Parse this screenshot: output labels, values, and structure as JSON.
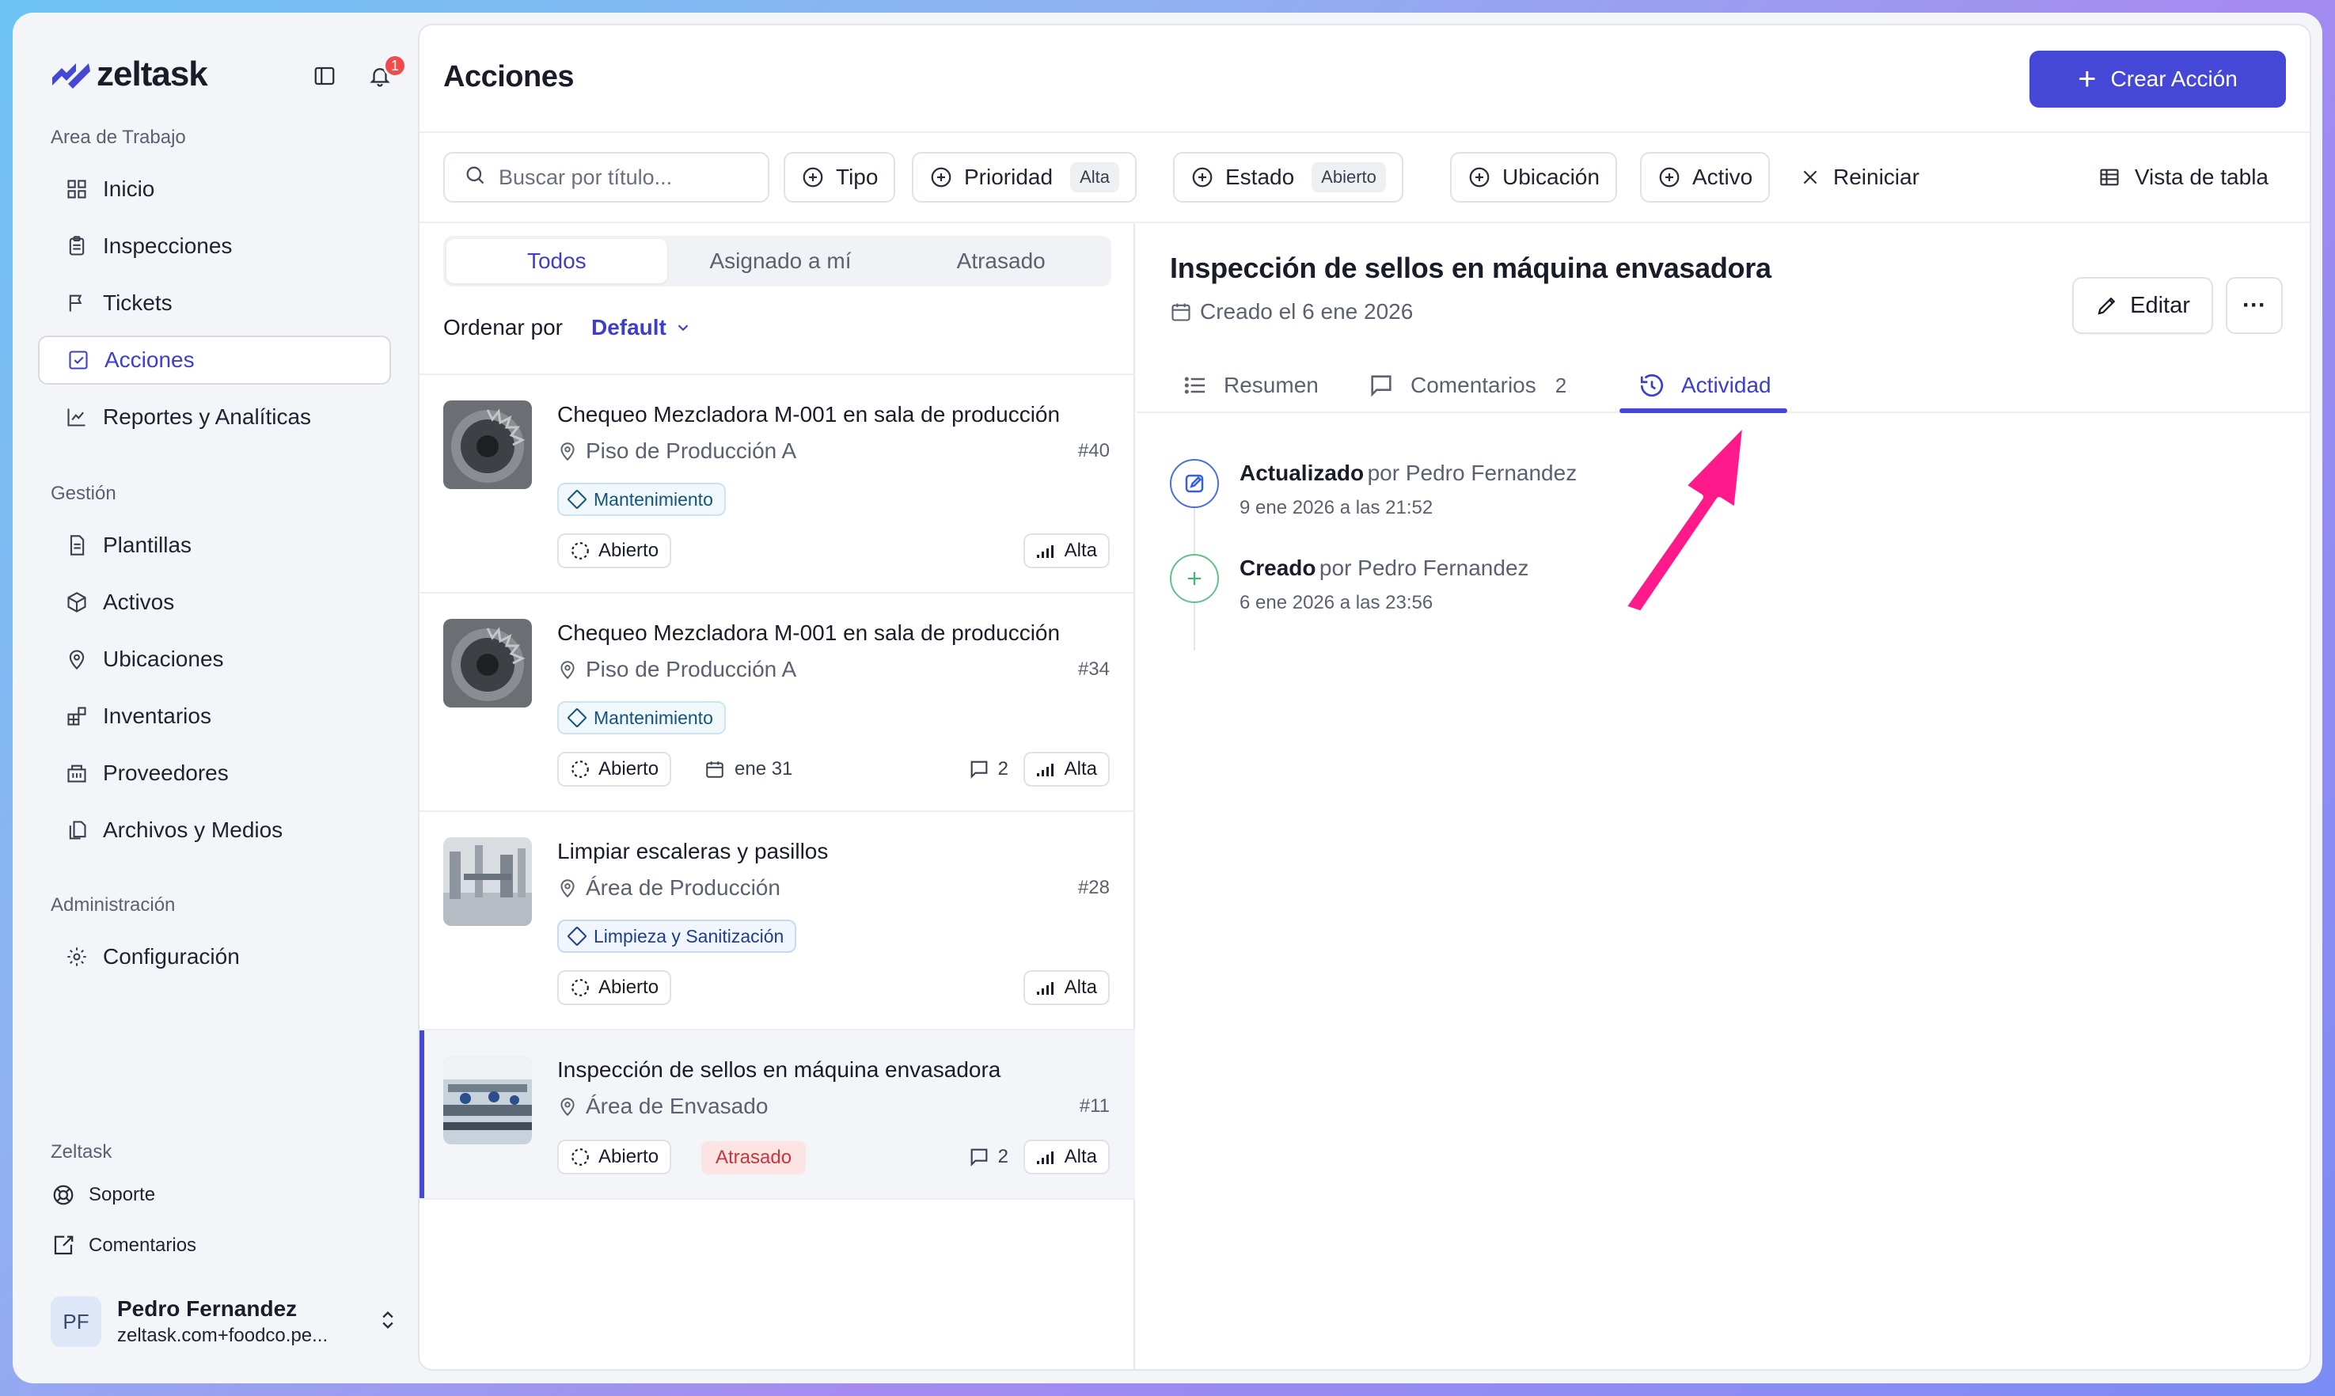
{
  "app": {
    "name": "zeltask",
    "notifications": "1"
  },
  "sidebar": {
    "workspace_label": "Area de Trabajo",
    "workspace_items": [
      {
        "label": "Inicio",
        "icon": "grid-icon"
      },
      {
        "label": "Inspecciones",
        "icon": "clipboard-icon"
      },
      {
        "label": "Tickets",
        "icon": "flag-icon"
      },
      {
        "label": "Acciones",
        "icon": "check-square-icon",
        "active": true
      },
      {
        "label": "Reportes y Analíticas",
        "icon": "chart-icon"
      }
    ],
    "management_label": "Gestión",
    "management_items": [
      {
        "label": "Plantillas",
        "icon": "file-icon"
      },
      {
        "label": "Activos",
        "icon": "box-icon"
      },
      {
        "label": "Ubicaciones",
        "icon": "pin-icon"
      },
      {
        "label": "Inventarios",
        "icon": "blocks-icon"
      },
      {
        "label": "Proveedores",
        "icon": "building-icon"
      },
      {
        "label": "Archivos y Medios",
        "icon": "files-icon"
      }
    ],
    "admin_label": "Administración",
    "admin_items": [
      {
        "label": "Configuración",
        "icon": "gear-icon"
      }
    ],
    "footer_label": "Zeltask",
    "footer_items": [
      {
        "label": "Soporte",
        "icon": "lifebuoy-icon"
      },
      {
        "label": "Comentarios",
        "icon": "external-message-icon"
      }
    ],
    "user": {
      "initials": "PF",
      "name": "Pedro Fernandez",
      "email": "zeltask.com+foodco.pe..."
    }
  },
  "header": {
    "title": "Acciones",
    "create_label": "Crear Acción"
  },
  "filters": {
    "search_placeholder": "Buscar por título...",
    "tipo": "Tipo",
    "prioridad": "Prioridad",
    "prioridad_value": "Alta",
    "estado": "Estado",
    "estado_value": "Abierto",
    "ubicacion": "Ubicación",
    "activo": "Activo",
    "reset": "Reiniciar",
    "table_view": "Vista de tabla"
  },
  "list": {
    "tabs": [
      "Todos",
      "Asignado a mí",
      "Atrasado"
    ],
    "sort_label": "Ordenar por",
    "sort_value": "Default",
    "items": [
      {
        "title": "Chequeo Mezcladora M-001 en sala de producción",
        "location": "Piso de Producción A",
        "number": "#40",
        "category": "Mantenimiento",
        "status": "Abierto",
        "priority": "Alta",
        "due": "",
        "comments": ""
      },
      {
        "title": "Chequeo Mezcladora M-001 en sala de producción",
        "location": "Piso de Producción A",
        "number": "#34",
        "category": "Mantenimiento",
        "status": "Abierto",
        "priority": "Alta",
        "due": "ene 31",
        "comments": "2"
      },
      {
        "title": "Limpiar escaleras y pasillos",
        "location": "Área de Producción",
        "number": "#28",
        "category": "Limpieza y Sanitización",
        "status": "Abierto",
        "priority": "Alta",
        "due": "",
        "comments": ""
      },
      {
        "title": "Inspección de sellos en máquina envasadora",
        "location": "Área de Envasado",
        "number": "#11",
        "category": "",
        "status": "Abierto",
        "late": "Atrasado",
        "priority": "Alta",
        "due": "",
        "comments": "2"
      }
    ]
  },
  "detail": {
    "title": "Inspección de sellos en máquina envasadora",
    "created": "Creado el 6 ene 2026",
    "edit_label": "Editar",
    "more_label": "···",
    "tabs": {
      "summary": "Resumen",
      "comments": "Comentarios",
      "comments_count": "2",
      "activity": "Actividad"
    },
    "activity": [
      {
        "action": "Actualizado",
        "by": "por Pedro Fernandez",
        "time": "9 ene 2026 a las 21:52"
      },
      {
        "action": "Creado",
        "by": "por Pedro Fernandez",
        "time": "6 ene 2026 a las 23:56"
      }
    ]
  },
  "colors": {
    "accent": "#4547d6",
    "annotation_arrow": "#ff1a8c",
    "late": "#c6363a"
  }
}
